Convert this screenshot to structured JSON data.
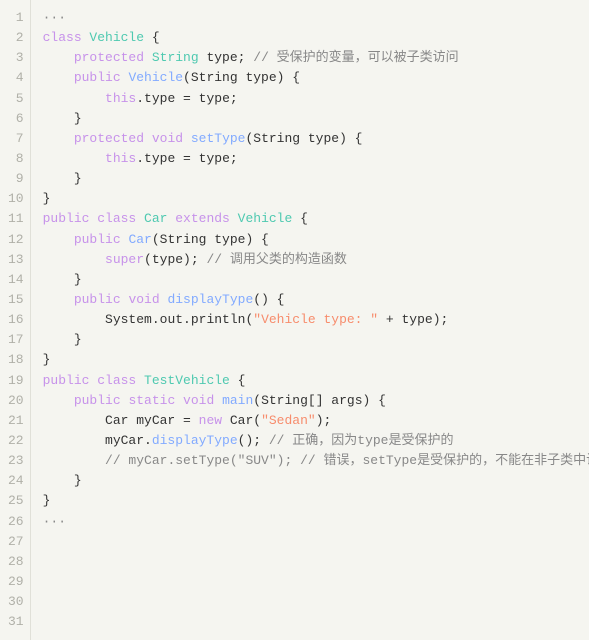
{
  "lines": [
    {
      "num": 1,
      "tokens": [
        {
          "t": "···",
          "c": "comment"
        }
      ]
    },
    {
      "num": 2,
      "tokens": [
        {
          "t": "class ",
          "c": "kw"
        },
        {
          "t": "Vehicle",
          "c": "classname"
        },
        {
          "t": " {",
          "c": "plain"
        }
      ]
    },
    {
      "num": 3,
      "tokens": [
        {
          "t": "    ",
          "c": "plain"
        },
        {
          "t": "protected ",
          "c": "kw"
        },
        {
          "t": "String",
          "c": "type"
        },
        {
          "t": " type; ",
          "c": "plain"
        },
        {
          "t": "// 受保护的变量，可以被子类访问",
          "c": "comment"
        }
      ]
    },
    {
      "num": 4,
      "tokens": [
        {
          "t": "",
          "c": "plain"
        }
      ]
    },
    {
      "num": 5,
      "tokens": [
        {
          "t": "    ",
          "c": "plain"
        },
        {
          "t": "public ",
          "c": "kw"
        },
        {
          "t": "Vehicle",
          "c": "fn"
        },
        {
          "t": "(String type) {",
          "c": "plain"
        }
      ]
    },
    {
      "num": 6,
      "tokens": [
        {
          "t": "        ",
          "c": "plain"
        },
        {
          "t": "this",
          "c": "kw"
        },
        {
          "t": ".type = type;",
          "c": "plain"
        }
      ]
    },
    {
      "num": 7,
      "tokens": [
        {
          "t": "    }",
          "c": "plain"
        }
      ]
    },
    {
      "num": 8,
      "tokens": [
        {
          "t": "",
          "c": "plain"
        }
      ]
    },
    {
      "num": 9,
      "tokens": [
        {
          "t": "    ",
          "c": "plain"
        },
        {
          "t": "protected ",
          "c": "kw"
        },
        {
          "t": "void ",
          "c": "kw"
        },
        {
          "t": "setType",
          "c": "fn"
        },
        {
          "t": "(String type) {",
          "c": "plain"
        }
      ]
    },
    {
      "num": 10,
      "tokens": [
        {
          "t": "        ",
          "c": "plain"
        },
        {
          "t": "this",
          "c": "kw"
        },
        {
          "t": ".type = type;",
          "c": "plain"
        }
      ]
    },
    {
      "num": 11,
      "tokens": [
        {
          "t": "    }",
          "c": "plain"
        }
      ]
    },
    {
      "num": 12,
      "tokens": [
        {
          "t": "}",
          "c": "plain"
        }
      ]
    },
    {
      "num": 13,
      "tokens": [
        {
          "t": "",
          "c": "plain"
        }
      ]
    },
    {
      "num": 14,
      "tokens": [
        {
          "t": "public ",
          "c": "kw"
        },
        {
          "t": "class ",
          "c": "kw"
        },
        {
          "t": "Car ",
          "c": "classname"
        },
        {
          "t": "extends ",
          "c": "kw"
        },
        {
          "t": "Vehicle",
          "c": "classname"
        },
        {
          "t": " {",
          "c": "plain"
        }
      ]
    },
    {
      "num": 15,
      "tokens": [
        {
          "t": "    ",
          "c": "plain"
        },
        {
          "t": "public ",
          "c": "kw"
        },
        {
          "t": "Car",
          "c": "fn"
        },
        {
          "t": "(String type) {",
          "c": "plain"
        }
      ]
    },
    {
      "num": 16,
      "tokens": [
        {
          "t": "        ",
          "c": "plain"
        },
        {
          "t": "super",
          "c": "super-kw"
        },
        {
          "t": "(type); ",
          "c": "plain"
        },
        {
          "t": "// 调用父类的构造函数",
          "c": "comment"
        }
      ]
    },
    {
      "num": 17,
      "tokens": [
        {
          "t": "    }",
          "c": "plain"
        }
      ]
    },
    {
      "num": 18,
      "tokens": [
        {
          "t": "",
          "c": "plain"
        }
      ]
    },
    {
      "num": 19,
      "tokens": [
        {
          "t": "    ",
          "c": "plain"
        },
        {
          "t": "public ",
          "c": "kw"
        },
        {
          "t": "void ",
          "c": "kw"
        },
        {
          "t": "displayType",
          "c": "fn"
        },
        {
          "t": "() {",
          "c": "plain"
        }
      ]
    },
    {
      "num": 20,
      "tokens": [
        {
          "t": "        System.",
          "c": "plain"
        },
        {
          "t": "out",
          "c": "plain"
        },
        {
          "t": ".println(",
          "c": "plain"
        },
        {
          "t": "\"Vehicle type: \"",
          "c": "str"
        },
        {
          "t": " + type);",
          "c": "plain"
        }
      ]
    },
    {
      "num": 21,
      "tokens": [
        {
          "t": "    }",
          "c": "plain"
        }
      ]
    },
    {
      "num": 22,
      "tokens": [
        {
          "t": "}",
          "c": "plain"
        }
      ]
    },
    {
      "num": 23,
      "tokens": [
        {
          "t": "",
          "c": "plain"
        }
      ]
    },
    {
      "num": 24,
      "tokens": [
        {
          "t": "public ",
          "c": "kw"
        },
        {
          "t": "class ",
          "c": "kw"
        },
        {
          "t": "TestVehicle",
          "c": "classname"
        },
        {
          "t": " {",
          "c": "plain"
        }
      ]
    },
    {
      "num": 25,
      "tokens": [
        {
          "t": "    ",
          "c": "plain"
        },
        {
          "t": "public ",
          "c": "kw"
        },
        {
          "t": "static ",
          "c": "kw"
        },
        {
          "t": "void ",
          "c": "kw"
        },
        {
          "t": "main",
          "c": "fn"
        },
        {
          "t": "(String[] args) {",
          "c": "plain"
        }
      ]
    },
    {
      "num": 26,
      "tokens": [
        {
          "t": "        Car myCar = ",
          "c": "plain"
        },
        {
          "t": "new ",
          "c": "kw"
        },
        {
          "t": "Car(",
          "c": "plain"
        },
        {
          "t": "\"Sedan\"",
          "c": "str"
        },
        {
          "t": ");",
          "c": "plain"
        }
      ]
    },
    {
      "num": 27,
      "tokens": [
        {
          "t": "        myCar.",
          "c": "plain"
        },
        {
          "t": "displayType",
          "c": "fn"
        },
        {
          "t": "(); ",
          "c": "plain"
        },
        {
          "t": "// 正确，因为type是受保护的",
          "c": "comment"
        }
      ]
    },
    {
      "num": 28,
      "tokens": [
        {
          "t": "        ",
          "c": "plain"
        },
        {
          "t": "// myCar.setType(\"SUV\"); // 错误，setType是受保护的，不能在非子类中访问",
          "c": "comment"
        }
      ]
    },
    {
      "num": 29,
      "tokens": [
        {
          "t": "    }",
          "c": "plain"
        }
      ]
    },
    {
      "num": 30,
      "tokens": [
        {
          "t": "}",
          "c": "plain"
        }
      ]
    },
    {
      "num": 31,
      "tokens": [
        {
          "t": "···",
          "c": "comment"
        }
      ]
    }
  ],
  "colorMap": {
    "kw": "#c792ea",
    "kw-blue": "#569cd6",
    "type": "#4ec9b0",
    "classname": "#4ec9b0",
    "fn": "#82aaff",
    "str": "#f78c6c",
    "comment": "#888888",
    "super-kw": "#c792ea",
    "plain": "#333333"
  }
}
